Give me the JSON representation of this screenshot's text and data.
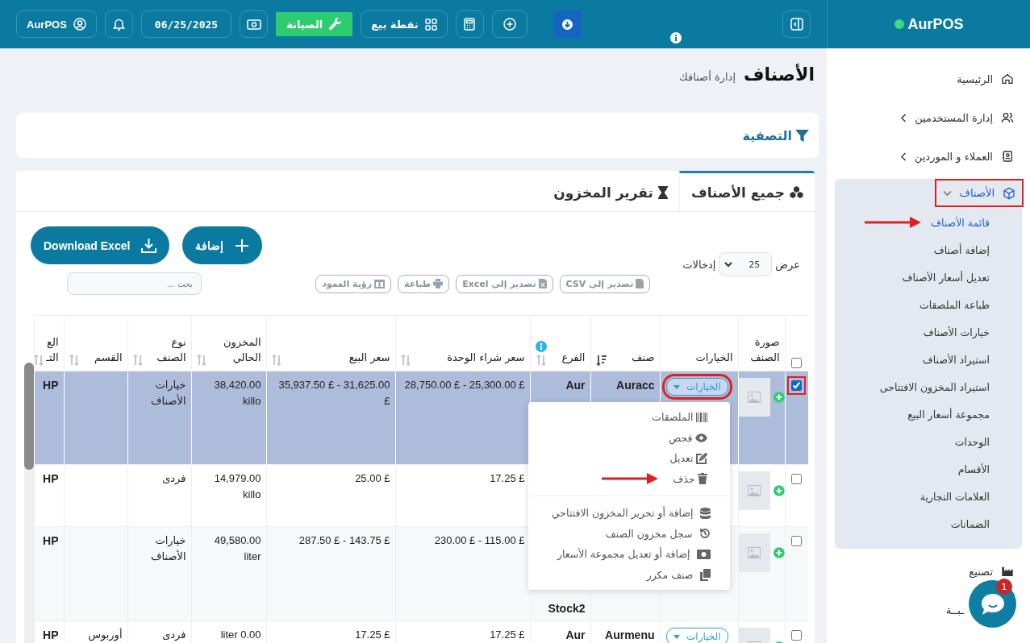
{
  "sidebar": {
    "brand": "AurPOS",
    "items": [
      {
        "kind": "link",
        "label": "الرئيسية"
      },
      {
        "kind": "group",
        "label": "إدارة المستخدمين",
        "expanded": false,
        "highlighted": false
      },
      {
        "kind": "group",
        "label": "العملاء و الموردين",
        "expanded": false,
        "highlighted": false
      },
      {
        "kind": "group",
        "label": "الأصناف",
        "expanded": true,
        "highlighted": true,
        "children": [
          {
            "label": "قائمة الأصناف",
            "selected": true,
            "pointed": true
          },
          {
            "label": "إضافة أصناف",
            "selected": false,
            "pointed": false
          },
          {
            "label": "تعديل أسعار الأصناف",
            "selected": false,
            "pointed": false
          },
          {
            "label": "طباعة الملصقات",
            "selected": false,
            "pointed": false
          },
          {
            "label": "خيارات الأصناف",
            "selected": false,
            "pointed": false
          },
          {
            "label": "استيراد الأصناف",
            "selected": false,
            "pointed": false
          },
          {
            "label": "استيراد المخزون الافتتاحى",
            "selected": false,
            "pointed": false
          },
          {
            "label": "مجموعة أسعار البيع",
            "selected": false,
            "pointed": false
          },
          {
            "label": "الوحدات",
            "selected": false,
            "pointed": false
          },
          {
            "label": "الأقسام",
            "selected": false,
            "pointed": false
          },
          {
            "label": "العلامات التجارية",
            "selected": false,
            "pointed": false
          },
          {
            "label": "الضمانات",
            "selected": false,
            "pointed": false
          }
        ]
      },
      {
        "kind": "link",
        "label": "تصنيع"
      },
      {
        "kind": "link",
        "label": "ـبــة"
      }
    ]
  },
  "topbar": {
    "buttons": [
      {
        "kind": "download"
      },
      {
        "kind": "add"
      },
      {
        "kind": "calculator"
      },
      {
        "kind": "pos",
        "label": "نقطة بيع"
      },
      {
        "kind": "maintenance",
        "label": "الصيانة"
      },
      {
        "kind": "cash"
      },
      {
        "kind": "date",
        "label": "06/25/2025"
      },
      {
        "kind": "bell"
      },
      {
        "kind": "user",
        "label": "AurPOS"
      }
    ]
  },
  "page": {
    "title": "الأصناف",
    "subtitle": "إدارة أصنافك"
  },
  "filter": {
    "label": "التصفية"
  },
  "tabs": [
    {
      "label": "جميع الأصناف",
      "kind": "cubes",
      "selected": true
    },
    {
      "label": "تقرير المخزون",
      "kind": "hourglass",
      "selected": false
    }
  ],
  "length": {
    "prefix": "عرض",
    "value": "25",
    "suffix": "إدخالات"
  },
  "actions": [
    {
      "kind": "add",
      "label": "إضافة"
    },
    {
      "kind": "download",
      "label": "Download Excel"
    }
  ],
  "exports": [
    {
      "kind": "csv",
      "label": "تصدير إلى CSV"
    },
    {
      "kind": "excel",
      "label": "تصدير إلى Excel"
    },
    {
      "kind": "print",
      "label": "طباعة"
    },
    {
      "kind": "columns",
      "label": "رؤية العمود"
    }
  ],
  "search": {
    "placeholder": "بحث ..."
  },
  "table": {
    "header_checked": false,
    "columns": [
      {
        "label": "صورة الصنف",
        "sortable": false,
        "sorted": false,
        "info": false
      },
      {
        "label": "الخيارات",
        "sortable": false,
        "sorted": false,
        "info": false
      },
      {
        "label": "صنف",
        "sortable": true,
        "sorted": true,
        "info": false
      },
      {
        "label": "الفرع",
        "sortable": true,
        "sorted": false,
        "info": true
      },
      {
        "label": "سعر شراء الوحدة",
        "sortable": true,
        "sorted": false,
        "info": false
      },
      {
        "label": "سعر البيع",
        "sortable": true,
        "sorted": false,
        "info": false
      },
      {
        "label": "المخزون الحالي",
        "sortable": true,
        "sorted": false,
        "info": false
      },
      {
        "label": "نوع الصنف",
        "sortable": true,
        "sorted": false,
        "info": false
      },
      {
        "label": "القسم",
        "sortable": true,
        "sorted": false,
        "info": false
      },
      {
        "label": "الع التـ",
        "sortable": true,
        "sorted": false,
        "info": false
      }
    ],
    "rows": [
      {
        "selected": true,
        "checked": true,
        "marked": true,
        "options": "الخيارات",
        "name": "Auracc",
        "branch": "Aur",
        "buy": "28,750.00 £ - 25,300.00 £",
        "sell": "35,937.50 £ - 31,625.00 £",
        "stock": "38,420.00 killo",
        "type": "خيارات الأصناف",
        "col_11": "HP",
        "menu": {
          "groups": [
            [
              {
                "kind": "barcode",
                "label": "الملصقات",
                "pointed": false
              },
              {
                "kind": "eye",
                "label": "فحص",
                "pointed": false
              },
              {
                "kind": "edit",
                "label": "تعديل",
                "pointed": false
              },
              {
                "kind": "trash",
                "label": "حذف",
                "pointed": true
              }
            ],
            [
              {
                "kind": "database",
                "label": "إضافة أو تحرير المخزون الافتتاحي",
                "pointed": false
              },
              {
                "kind": "history",
                "label": "سجل مخزون الصنف",
                "pointed": false
              },
              {
                "kind": "money",
                "label": "إضافة أو تعديل مجموعة الأسعار",
                "pointed": false
              },
              {
                "kind": "copy",
                "label": "صنف مكرر",
                "pointed": false
              }
            ]
          ]
        }
      },
      {
        "selected": false,
        "checked": false,
        "marked": false,
        "buy": "17.25 £",
        "sell": "25.00 £",
        "stock": "14,979.00 killo",
        "type": "فردى",
        "col_11": "HP"
      },
      {
        "selected": false,
        "checked": false,
        "marked": false,
        "branch_note": "Stock2",
        "buy": "230.00 £ - 115.00 £",
        "sell": "287.50 £ - 143.75 £",
        "stock": "49,580.00 liter",
        "type": "خيارات الأصناف",
        "col_11": "HP"
      },
      {
        "selected": false,
        "checked": false,
        "marked": false,
        "options": "الخيارات",
        "name": "Aurmenu",
        "branch": "Aur",
        "buy": "17.25 £",
        "sell": "17.25 £",
        "stock": "liter 0.00",
        "type": "فردى",
        "section": "أوربوس",
        "col_11": "HP"
      }
    ]
  },
  "chat": {
    "badge": "1"
  }
}
